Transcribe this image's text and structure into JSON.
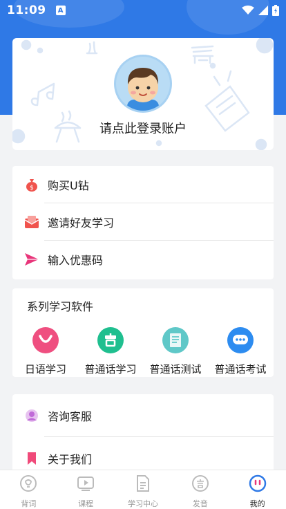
{
  "status_bar": {
    "time": "11:09",
    "notification_icon": "A"
  },
  "profile": {
    "login_prompt": "请点此登录账户",
    "avatar_icon": "boy-avatar-icon"
  },
  "menu1": {
    "items": [
      {
        "label": "购买U钻",
        "icon": "money-bag-icon",
        "color": "#f0534d"
      },
      {
        "label": "邀请好友学习",
        "icon": "envelope-icon",
        "color": "#f0534d"
      },
      {
        "label": "输入优惠码",
        "icon": "paper-plane-icon",
        "color": "#e8357a"
      }
    ]
  },
  "series": {
    "title": "系列学习软件",
    "apps": [
      {
        "label": "日语学习",
        "color": "#ef4f80"
      },
      {
        "label": "普通话学习",
        "color": "#1fbf8f"
      },
      {
        "label": "普通话测试",
        "color": "#5fc8c8"
      },
      {
        "label": "普通话考试",
        "color": "#2d8cf0"
      }
    ]
  },
  "menu2": {
    "items": [
      {
        "label": "咨询客服",
        "icon": "customer-service-icon",
        "color": "#c06ad8"
      },
      {
        "label": "关于我们",
        "icon": "bookmark-icon",
        "color": "#f04a7a"
      }
    ]
  },
  "tabbar": {
    "tabs": [
      {
        "label": "背词",
        "active": false
      },
      {
        "label": "课程",
        "active": false
      },
      {
        "label": "学习中心",
        "active": false
      },
      {
        "label": "发音",
        "active": false
      },
      {
        "label": "我的",
        "active": true
      }
    ]
  },
  "colors": {
    "primary": "#2f79e6",
    "background": "#f2f3f5"
  }
}
